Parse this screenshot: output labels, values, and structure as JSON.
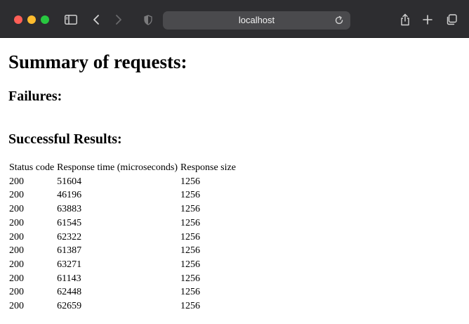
{
  "browser": {
    "address": "localhost"
  },
  "page": {
    "title": "Summary of requests:",
    "failures_heading": "Failures:",
    "success_heading": "Successful Results:",
    "table": {
      "headers": [
        "Status code",
        "Response time (microseconds)",
        "Response size"
      ],
      "rows": [
        [
          "200",
          "51604",
          "1256"
        ],
        [
          "200",
          "46196",
          "1256"
        ],
        [
          "200",
          "63883",
          "1256"
        ],
        [
          "200",
          "61545",
          "1256"
        ],
        [
          "200",
          "62322",
          "1256"
        ],
        [
          "200",
          "61387",
          "1256"
        ],
        [
          "200",
          "63271",
          "1256"
        ],
        [
          "200",
          "61143",
          "1256"
        ],
        [
          "200",
          "62448",
          "1256"
        ],
        [
          "200",
          "62659",
          "1256"
        ]
      ]
    }
  },
  "colors": {
    "toolbar_bg": "#2d2d30",
    "close": "#ff5f57",
    "minimize": "#febc2e",
    "zoom": "#28c840"
  },
  "icons": [
    "sidebar-icon",
    "back-icon",
    "forward-icon",
    "shield-icon",
    "reload-icon",
    "share-icon",
    "new-tab-icon",
    "tab-overview-icon"
  ]
}
